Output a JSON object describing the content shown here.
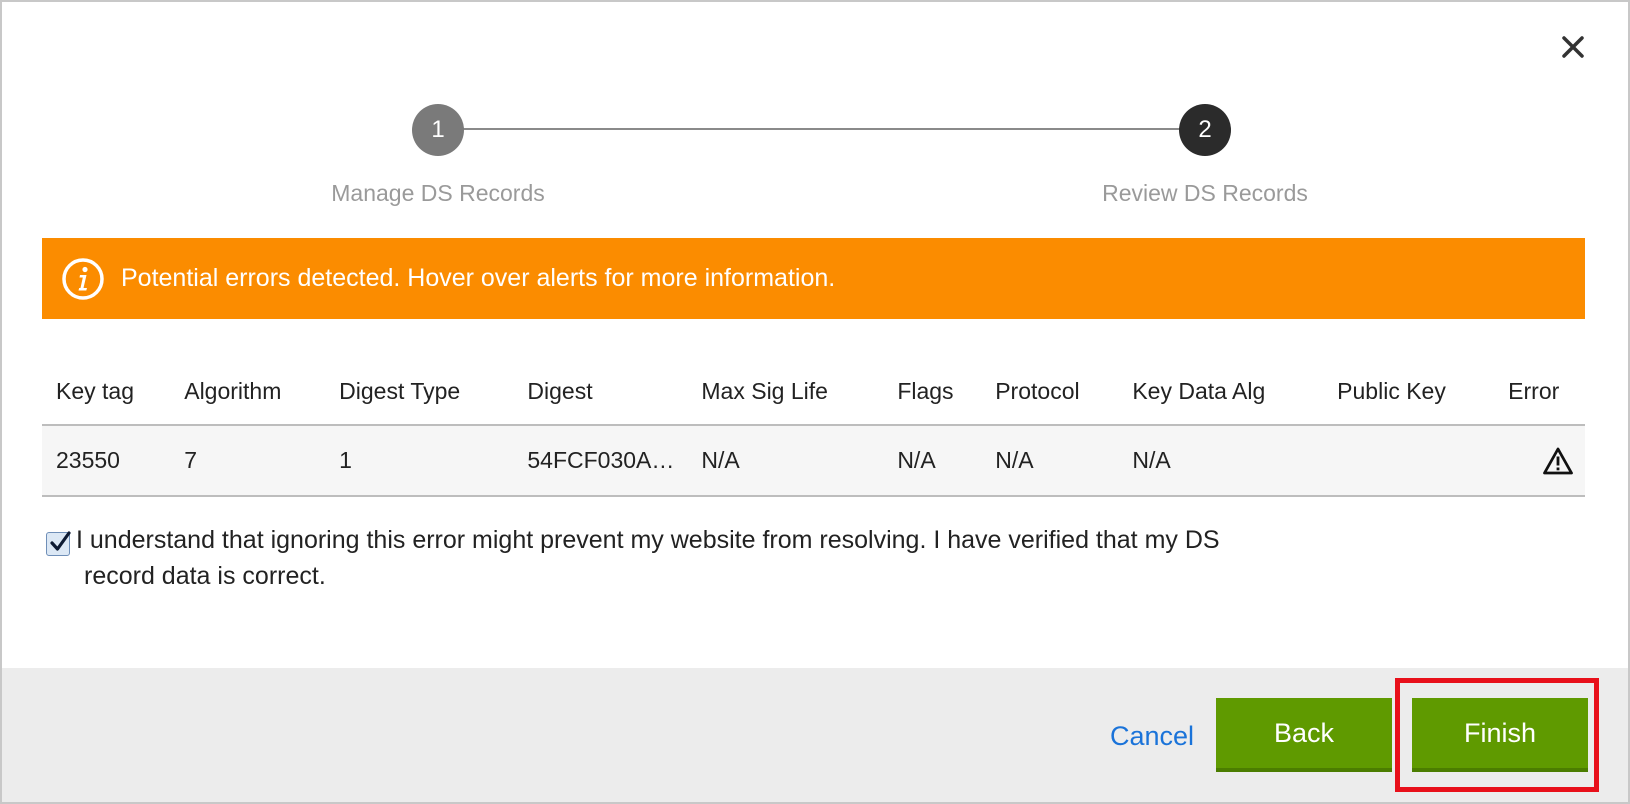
{
  "dialog": {
    "close_label": "✕"
  },
  "stepper": {
    "steps": [
      {
        "number": "1",
        "label": "Manage DS Records"
      },
      {
        "number": "2",
        "label": "Review DS Records"
      }
    ]
  },
  "alert": {
    "icon": "info-icon",
    "text": "Potential errors detected. Hover over alerts for more information.",
    "color": "#fb8c00"
  },
  "table": {
    "headers": [
      "Key tag",
      "Algorithm",
      "Digest Type",
      "Digest",
      "Max Sig Life",
      "Flags",
      "Protocol",
      "Key Data Alg",
      "Public Key",
      "Error"
    ],
    "rows": [
      [
        "23550",
        "7",
        "1",
        "54FCF030A…",
        "N/A",
        "N/A",
        "N/A",
        "N/A",
        "",
        ""
      ]
    ],
    "error_icon": "warning-icon"
  },
  "acknowledgement": {
    "checked": true,
    "line1": "I understand that ignoring this error might prevent my website from resolving. I have verified that my DS",
    "line2": "record data is correct."
  },
  "footer": {
    "cancel_label": "Cancel",
    "back_label": "Back",
    "finish_label": "Finish",
    "button_color": "#5f9a00",
    "link_color": "#1a73d9",
    "highlight_color": "#e8101a"
  }
}
